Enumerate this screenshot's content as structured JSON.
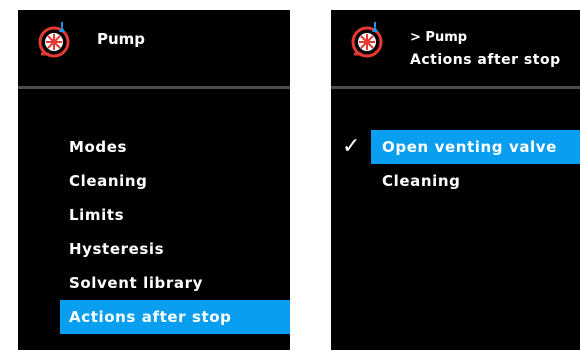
{
  "left_screen": {
    "title": "Pump",
    "menu": [
      {
        "label": "Modes"
      },
      {
        "label": "Cleaning"
      },
      {
        "label": "Limits"
      },
      {
        "label": "Hysteresis"
      },
      {
        "label": "Solvent library"
      },
      {
        "label": "Actions after stop"
      }
    ],
    "selected_index": 5
  },
  "right_screen": {
    "breadcrumb": "> Pump",
    "title": "Actions after stop",
    "menu": [
      {
        "label": "Open venting valve",
        "checked": true
      },
      {
        "label": "Cleaning",
        "checked": false
      }
    ],
    "selected_index": 0,
    "check_glyph": "✓"
  },
  "colors": {
    "screen_bg": "#000000",
    "highlight": "#0a9ef0",
    "divider": "#4d4d4d",
    "icon_red": "#e53935"
  }
}
